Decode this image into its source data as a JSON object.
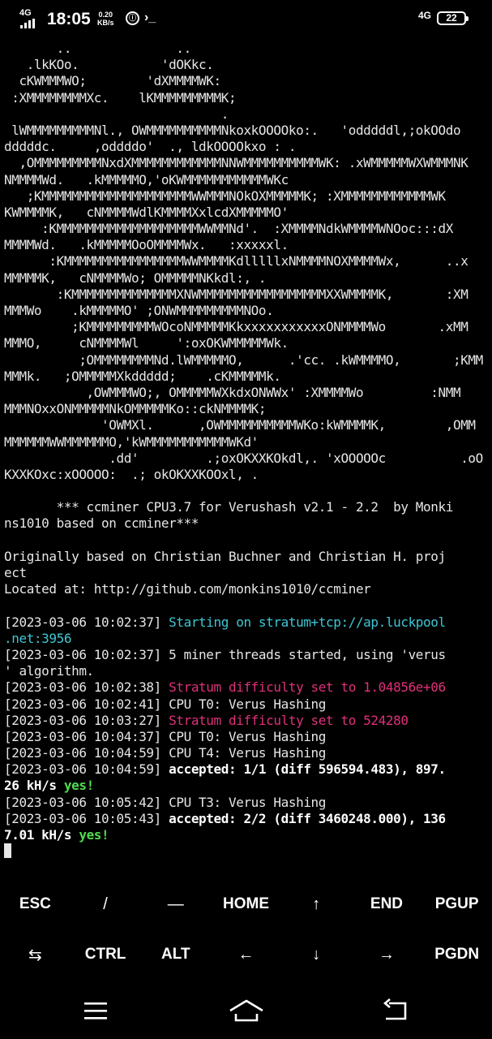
{
  "status_bar": {
    "network_left": "4G",
    "time": "18:05",
    "speed_value": "0.20",
    "speed_unit": "KB/s",
    "network_right": "4G",
    "battery": "22"
  },
  "terminal": {
    "lines": [
      {
        "t": "       ..              .."
      },
      {
        "t": "   .lkKOo.           'dOKkc."
      },
      {
        "t": "  cKWMMMWO;        'dXMMMMWK:"
      },
      {
        "t": " :XMMMMMMMMXc.    lKMMMMMMMMMK;"
      },
      {
        "t": "                             ."
      },
      {
        "t": " lWMMMMMMMMMNl., OWMMMMMMMMMMNkoxkOOOOko:.   'odddddl,;okOOdo"
      },
      {
        "t": "dddddc.     ,oddddo'  ., ldkOOOOkxo : ."
      },
      {
        "t": "  ,OMMMMMMMMMNxdXMMMMMMMMMMMMNNWMMMMMMMMMMWK: .xWMMMMMWXWMMMNK"
      },
      {
        "t": "NMMMMWd.   .kMMMMMO,'oKWMMMMMMMMMMMWKc"
      },
      {
        "t": "   ;KMMMMMMMMMMMMMMMMMMMMWWMMMNOkOXMMMMMK; :XMMMMMMMMMMMMWK"
      },
      {
        "t": "KWMMMMK,   cNMMMMWdlKMMMMXxlcdXMMMMMO'"
      },
      {
        "t": "     :KMMMMMMMMMMMMMMMMMMMWWMMNd'.  :XMMMMNdkWMMMMWNOoc:::dX"
      },
      {
        "t": "MMMMWd.   .kMMMMMOoOMMMMWx.   :xxxxxl."
      },
      {
        "t": "      :KMMMMMMMMMMMMMMMMWWMMMMKdlllllxNMMMMNOXMMMMWx,      ..x"
      },
      {
        "t": "MMMMMK,   cNMMMMWo; OMMMMMNKkdl:, ."
      },
      {
        "t": "       :KMMMMMMMMMMMMMMXNWMMMMMMMMMMMMMMMMMXXWMMMMK,       :XM"
      },
      {
        "t": "MMMWo    .kMMMMMO' ;ONWMMMMMMMMMNOo."
      },
      {
        "t": "         ;KMMMMMMMMMWOcoNMMMMMKkxxxxxxxxxxxONMMMMWo       .xMM"
      },
      {
        "t": "MMMO,     cNMMMMWl     ':oxOKWMMMMMWk."
      },
      {
        "t": "          ;OMMMMMMMMNd.lWMMMMMO,      .'cc. .kWMMMMO,       ;KMM"
      },
      {
        "t": "MMMk.   ;OMMMMMXkddddd;    .cKMMMMMk."
      },
      {
        "t": "           ,OWMMMWO;, OMMMMMWXkdxONWWx' :XMMMMWo         :NMM"
      },
      {
        "t": "MMMNOxxONMMMMMNkOMMMMMKo::ckNMMMMK;"
      },
      {
        "t": "             'OWMXl.      ,OWMMMMMMMMMMWKo:kWMMMMK,        ,OMM"
      },
      {
        "t": "MMMMMMWWMMMMMMO,'kWMMMMMMMMMMMWKd'"
      },
      {
        "t": "              .dd'         .;oxOKXXKOkdl,. 'xOOOOOc          .oO"
      },
      {
        "t": "KXXKOxc:xOOOOO:  .; okOKXXKOOxl, ."
      },
      {
        "t": ""
      },
      {
        "t": "       *** ccminer CPU3.7 for Verushash v2.1 - 2.2  by Monki"
      },
      {
        "t": "ns1010 based on ccminer***"
      },
      {
        "t": ""
      },
      {
        "t": "Originally based on Christian Buchner and Christian H. proj"
      },
      {
        "t": "ect"
      },
      {
        "t": "Located at: http://github.com/monkins1010/ccminer"
      },
      {
        "t": ""
      },
      {
        "p": "[2023-03-06 10:02:37] ",
        "c": "Starting on stratum+tcp://ap.luckpool",
        "k": "cyan"
      },
      {
        "c": ".net:3956",
        "k": "cyan"
      },
      {
        "t": "[2023-03-06 10:02:37] 5 miner threads started, using 'verus"
      },
      {
        "t": "' algorithm."
      },
      {
        "p": "[2023-03-06 10:02:38] ",
        "c": "Stratum difficulty set to 1.04856e+06",
        "k": "mag"
      },
      {
        "t": "[2023-03-06 10:02:41] CPU T0: Verus Hashing"
      },
      {
        "p": "[2023-03-06 10:03:27] ",
        "c": "Stratum difficulty set to 524280",
        "k": "mag"
      },
      {
        "t": "[2023-03-06 10:04:37] CPU T0: Verus Hashing"
      },
      {
        "t": "[2023-03-06 10:04:59] CPU T4: Verus Hashing"
      },
      {
        "p": "[2023-03-06 10:04:59] ",
        "c": "accepted: 1/1 (diff 596594.483), 897.",
        "k": "bold"
      },
      {
        "c": "26 kH/s ",
        "k": "bold",
        "s": "yes!"
      },
      {
        "t": "[2023-03-06 10:05:42] CPU T3: Verus Hashing"
      },
      {
        "p": "[2023-03-06 10:05:43] ",
        "c": "accepted: 2/2 (diff 3460248.000), 136",
        "k": "bold"
      },
      {
        "c": "7.01 kH/s ",
        "k": "bold",
        "s": "yes!"
      }
    ]
  },
  "extra_keys": {
    "row1": [
      "ESC",
      "/",
      "—",
      "HOME",
      "↑",
      "END",
      "PGUP"
    ],
    "row2": [
      "⇆",
      "CTRL",
      "ALT",
      "←",
      "↓",
      "→",
      "PGDN"
    ]
  },
  "nav": {
    "icons": [
      "menu-icon",
      "home-icon",
      "back-icon"
    ]
  }
}
